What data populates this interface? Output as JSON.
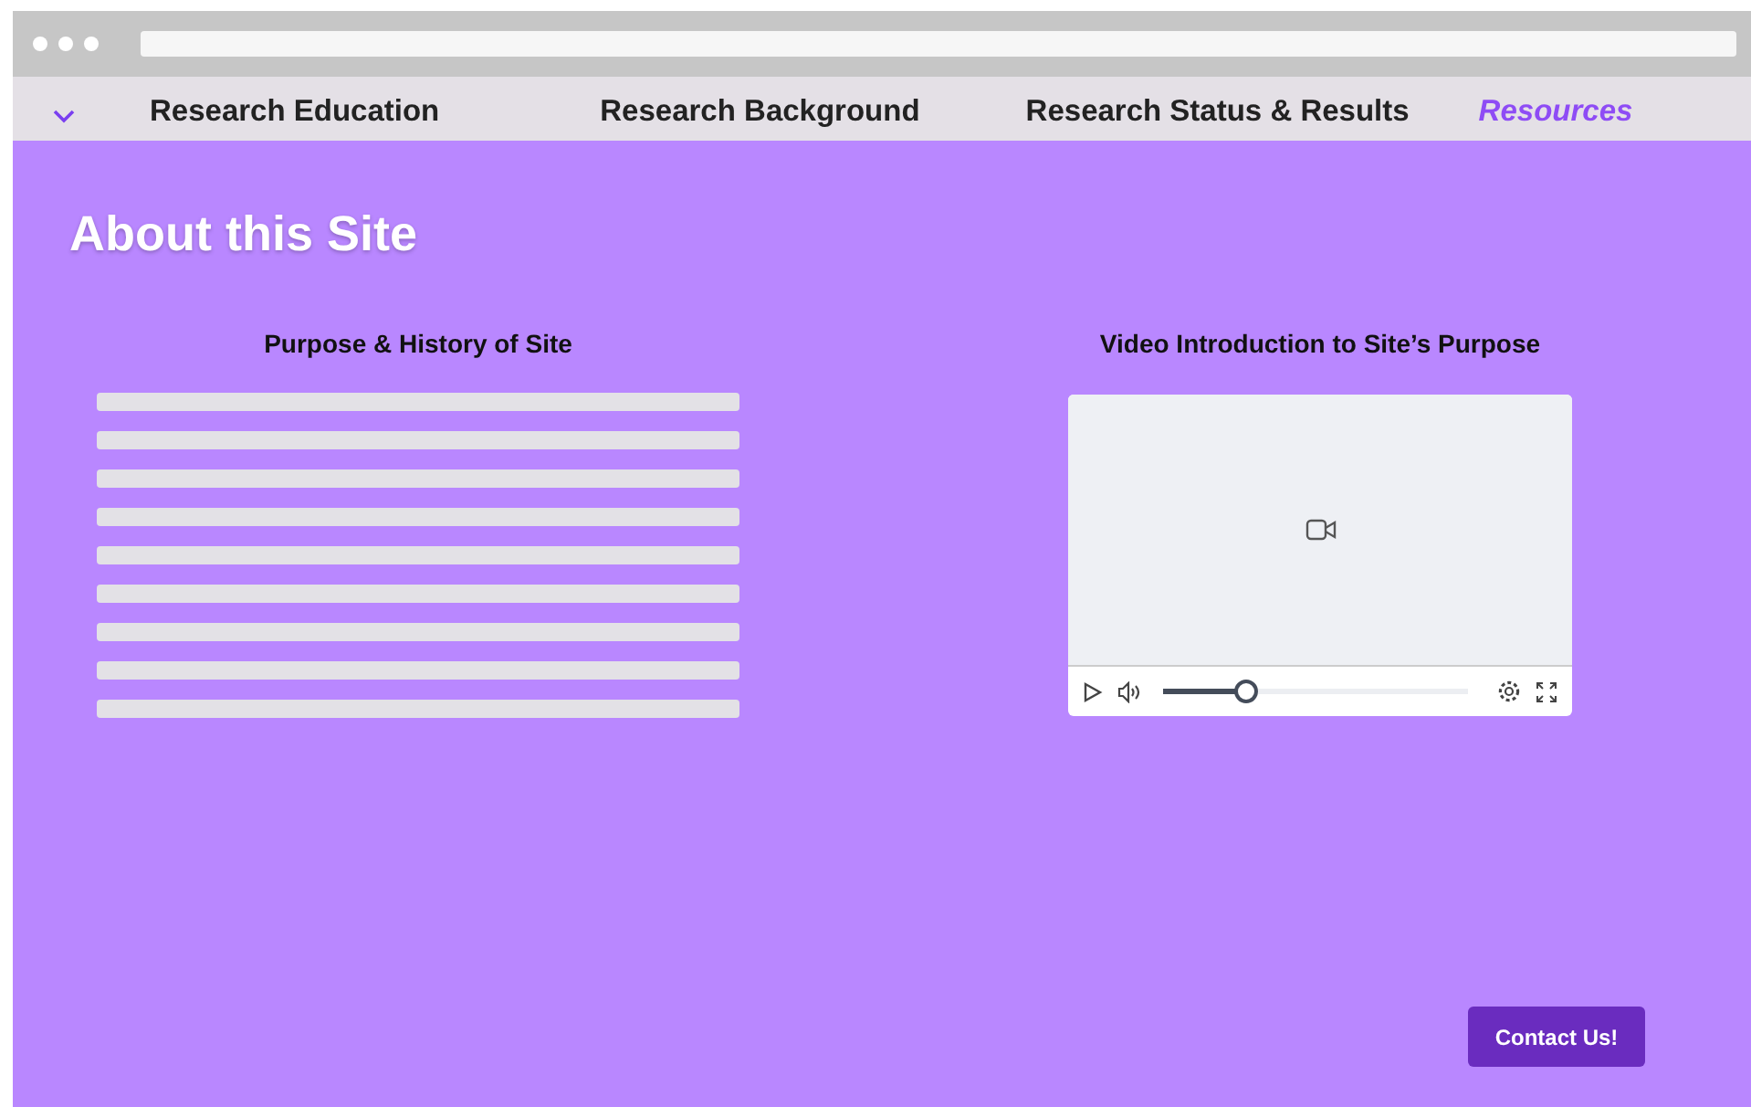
{
  "nav": {
    "items": [
      {
        "label": "Research Education",
        "selected": false
      },
      {
        "label": "Research Background",
        "selected": false
      },
      {
        "label": "Research Status & Results",
        "selected": false
      },
      {
        "label": "Resources",
        "selected": true
      }
    ]
  },
  "page_title": "About this Site",
  "purpose": {
    "heading": "Purpose & History of Site"
  },
  "video": {
    "heading": "Video Introduction to Site’s Purpose",
    "progress": {
      "level": 0.27
    }
  },
  "contact_button": "Contact Us!"
}
